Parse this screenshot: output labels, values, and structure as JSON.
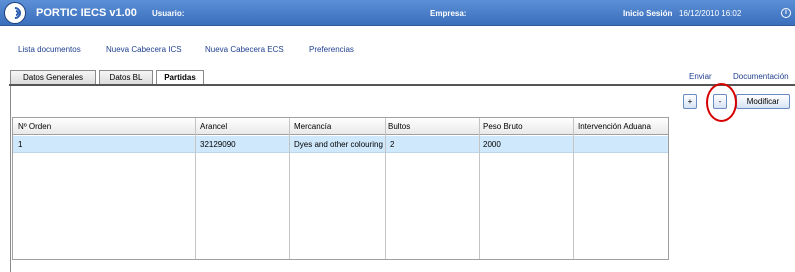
{
  "header": {
    "app_title": "PORTIC IECS v1.00",
    "user_label": "Usuario:",
    "company_label": "Empresa:",
    "session_label": "Inicio Sesión",
    "session_date": "16/12/2010 16:02",
    "info_glyph": "i"
  },
  "menu": {
    "items": [
      "Lista documentos",
      "Nueva Cabecera ICS",
      "Nueva Cabecera ECS",
      "Preferencias"
    ]
  },
  "tabs": {
    "items": [
      "Datos Generales",
      "Datos BL",
      "Partidas"
    ],
    "active": "Partidas",
    "actions": [
      "Enviar",
      "Documentación"
    ]
  },
  "toolbar": {
    "add_label": "+",
    "remove_label": "-",
    "modify_label": "Modificar"
  },
  "annotation": {
    "color": "#d60000"
  },
  "table": {
    "columns": [
      "Nº Orden",
      "Arancel",
      "Mercancía",
      "Bultos",
      "Peso Bruto",
      "Intervención Aduana"
    ],
    "rows": [
      [
        "1",
        "32129090",
        "Dyes and other colouring",
        "2",
        "2000",
        ""
      ]
    ]
  },
  "colors": {
    "header_bg": "#3b6fbd",
    "link": "#1f3f8f",
    "selected_row": "#cfe8fb"
  }
}
